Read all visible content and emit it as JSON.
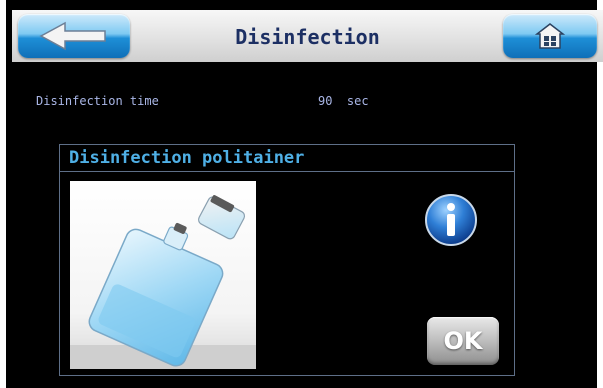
{
  "header": {
    "title": "Disinfection",
    "back_icon": "arrow-left-icon",
    "home_icon": "home-icon"
  },
  "setting": {
    "label": "Disinfection time",
    "value": "90  sec"
  },
  "dialog": {
    "title": "Disinfection politainer",
    "image_icon": "politainer-image",
    "info_icon": "info-icon",
    "ok_label": "OK"
  },
  "colors": {
    "background": "#000000",
    "header_title": "#1c2f63",
    "setting_text": "#a9b6e6",
    "dialog_title": "#4fb0e6",
    "button_blue": "#1e8fd7"
  }
}
